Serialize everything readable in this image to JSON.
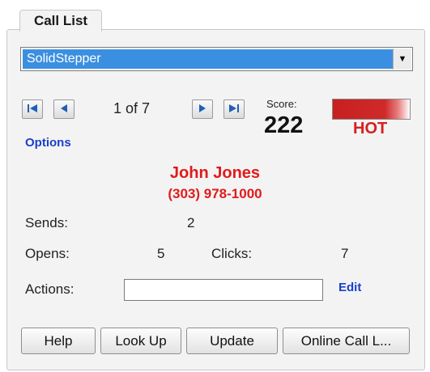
{
  "tab": {
    "label": "Call List"
  },
  "dropdown": {
    "selected": "SolidStepper",
    "arrow_icon": "chevron-down-icon"
  },
  "navigation": {
    "page_indicator": "1 of 7",
    "first_icon": "skip-first-icon",
    "prev_icon": "prev-icon",
    "next_icon": "next-icon",
    "last_icon": "skip-last-icon",
    "options_label": "Options"
  },
  "score": {
    "label": "Score:",
    "value": "222",
    "heat_label": "HOT",
    "heat_level_percent": 85,
    "heat_color": "#cf2a2a"
  },
  "contact": {
    "name": "John Jones",
    "phone": "(303) 978-1000",
    "highlight_color": "#e01b1b"
  },
  "stats": {
    "sends_label": "Sends:",
    "sends_value": "2",
    "opens_label": "Opens:",
    "opens_value": "5",
    "clicks_label": "Clicks:",
    "clicks_value": "7"
  },
  "actions": {
    "label": "Actions:",
    "value": "",
    "edit_label": "Edit"
  },
  "buttons": {
    "help": "Help",
    "lookup": "Look Up",
    "update": "Update",
    "online": "Online Call L..."
  },
  "colors": {
    "link": "#1a3fc8",
    "selection": "#3b8fe0"
  }
}
